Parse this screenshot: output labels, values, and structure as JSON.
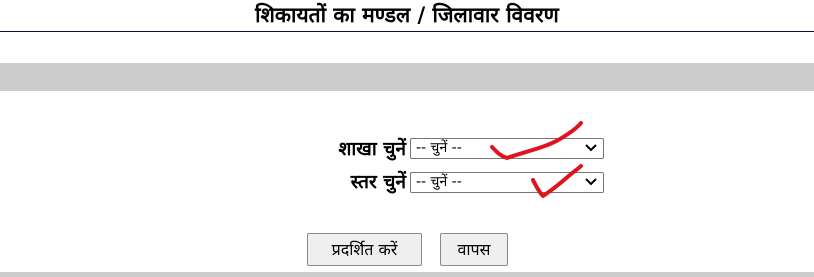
{
  "page": {
    "title": "शिकायतों का मण्डल / जिलावार विवरण"
  },
  "form": {
    "branch": {
      "label": "शाखा चुनें",
      "selected": "-- चुनें --"
    },
    "level": {
      "label": "स्तर चुनें",
      "selected": "-- चुनें --"
    }
  },
  "buttons": {
    "show_label": "प्रदर्शित करें",
    "back_label": "वापस"
  },
  "colors": {
    "band": "#cccccc",
    "rule": "#0a0a3a",
    "annotation_mark": "#e0141e"
  },
  "icons": {
    "dropdown": "chevron-down-icon",
    "annotation": "checkmark-icon"
  }
}
